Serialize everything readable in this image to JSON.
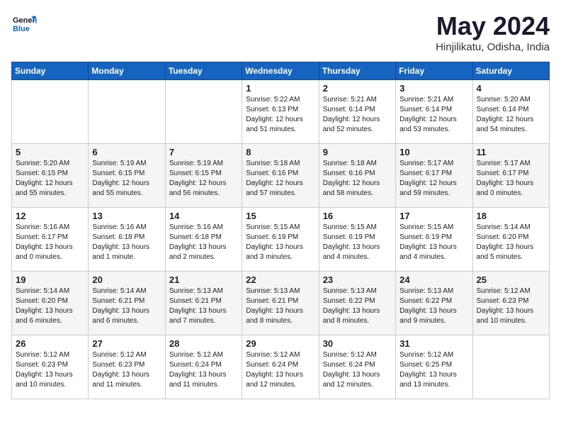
{
  "header": {
    "logo_line1": "General",
    "logo_line2": "Blue",
    "title": "May 2024",
    "subtitle": "Hinjilikatu, Odisha, India"
  },
  "days_of_week": [
    "Sunday",
    "Monday",
    "Tuesday",
    "Wednesday",
    "Thursday",
    "Friday",
    "Saturday"
  ],
  "weeks": [
    [
      {
        "num": "",
        "info": ""
      },
      {
        "num": "",
        "info": ""
      },
      {
        "num": "",
        "info": ""
      },
      {
        "num": "1",
        "info": "Sunrise: 5:22 AM\nSunset: 6:13 PM\nDaylight: 12 hours\nand 51 minutes."
      },
      {
        "num": "2",
        "info": "Sunrise: 5:21 AM\nSunset: 6:14 PM\nDaylight: 12 hours\nand 52 minutes."
      },
      {
        "num": "3",
        "info": "Sunrise: 5:21 AM\nSunset: 6:14 PM\nDaylight: 12 hours\nand 53 minutes."
      },
      {
        "num": "4",
        "info": "Sunrise: 5:20 AM\nSunset: 6:14 PM\nDaylight: 12 hours\nand 54 minutes."
      }
    ],
    [
      {
        "num": "5",
        "info": "Sunrise: 5:20 AM\nSunset: 6:15 PM\nDaylight: 12 hours\nand 55 minutes."
      },
      {
        "num": "6",
        "info": "Sunrise: 5:19 AM\nSunset: 6:15 PM\nDaylight: 12 hours\nand 55 minutes."
      },
      {
        "num": "7",
        "info": "Sunrise: 5:19 AM\nSunset: 6:15 PM\nDaylight: 12 hours\nand 56 minutes."
      },
      {
        "num": "8",
        "info": "Sunrise: 5:18 AM\nSunset: 6:16 PM\nDaylight: 12 hours\nand 57 minutes."
      },
      {
        "num": "9",
        "info": "Sunrise: 5:18 AM\nSunset: 6:16 PM\nDaylight: 12 hours\nand 58 minutes."
      },
      {
        "num": "10",
        "info": "Sunrise: 5:17 AM\nSunset: 6:17 PM\nDaylight: 12 hours\nand 59 minutes."
      },
      {
        "num": "11",
        "info": "Sunrise: 5:17 AM\nSunset: 6:17 PM\nDaylight: 13 hours\nand 0 minutes."
      }
    ],
    [
      {
        "num": "12",
        "info": "Sunrise: 5:16 AM\nSunset: 6:17 PM\nDaylight: 13 hours\nand 0 minutes."
      },
      {
        "num": "13",
        "info": "Sunrise: 5:16 AM\nSunset: 6:18 PM\nDaylight: 13 hours\nand 1 minute."
      },
      {
        "num": "14",
        "info": "Sunrise: 5:16 AM\nSunset: 6:18 PM\nDaylight: 13 hours\nand 2 minutes."
      },
      {
        "num": "15",
        "info": "Sunrise: 5:15 AM\nSunset: 6:19 PM\nDaylight: 13 hours\nand 3 minutes."
      },
      {
        "num": "16",
        "info": "Sunrise: 5:15 AM\nSunset: 6:19 PM\nDaylight: 13 hours\nand 4 minutes."
      },
      {
        "num": "17",
        "info": "Sunrise: 5:15 AM\nSunset: 6:19 PM\nDaylight: 13 hours\nand 4 minutes."
      },
      {
        "num": "18",
        "info": "Sunrise: 5:14 AM\nSunset: 6:20 PM\nDaylight: 13 hours\nand 5 minutes."
      }
    ],
    [
      {
        "num": "19",
        "info": "Sunrise: 5:14 AM\nSunset: 6:20 PM\nDaylight: 13 hours\nand 6 minutes."
      },
      {
        "num": "20",
        "info": "Sunrise: 5:14 AM\nSunset: 6:21 PM\nDaylight: 13 hours\nand 6 minutes."
      },
      {
        "num": "21",
        "info": "Sunrise: 5:13 AM\nSunset: 6:21 PM\nDaylight: 13 hours\nand 7 minutes."
      },
      {
        "num": "22",
        "info": "Sunrise: 5:13 AM\nSunset: 6:21 PM\nDaylight: 13 hours\nand 8 minutes."
      },
      {
        "num": "23",
        "info": "Sunrise: 5:13 AM\nSunset: 6:22 PM\nDaylight: 13 hours\nand 8 minutes."
      },
      {
        "num": "24",
        "info": "Sunrise: 5:13 AM\nSunset: 6:22 PM\nDaylight: 13 hours\nand 9 minutes."
      },
      {
        "num": "25",
        "info": "Sunrise: 5:12 AM\nSunset: 6:23 PM\nDaylight: 13 hours\nand 10 minutes."
      }
    ],
    [
      {
        "num": "26",
        "info": "Sunrise: 5:12 AM\nSunset: 6:23 PM\nDaylight: 13 hours\nand 10 minutes."
      },
      {
        "num": "27",
        "info": "Sunrise: 5:12 AM\nSunset: 6:23 PM\nDaylight: 13 hours\nand 11 minutes."
      },
      {
        "num": "28",
        "info": "Sunrise: 5:12 AM\nSunset: 6:24 PM\nDaylight: 13 hours\nand 11 minutes."
      },
      {
        "num": "29",
        "info": "Sunrise: 5:12 AM\nSunset: 6:24 PM\nDaylight: 13 hours\nand 12 minutes."
      },
      {
        "num": "30",
        "info": "Sunrise: 5:12 AM\nSunset: 6:24 PM\nDaylight: 13 hours\nand 12 minutes."
      },
      {
        "num": "31",
        "info": "Sunrise: 5:12 AM\nSunset: 6:25 PM\nDaylight: 13 hours\nand 13 minutes."
      },
      {
        "num": "",
        "info": ""
      }
    ]
  ]
}
